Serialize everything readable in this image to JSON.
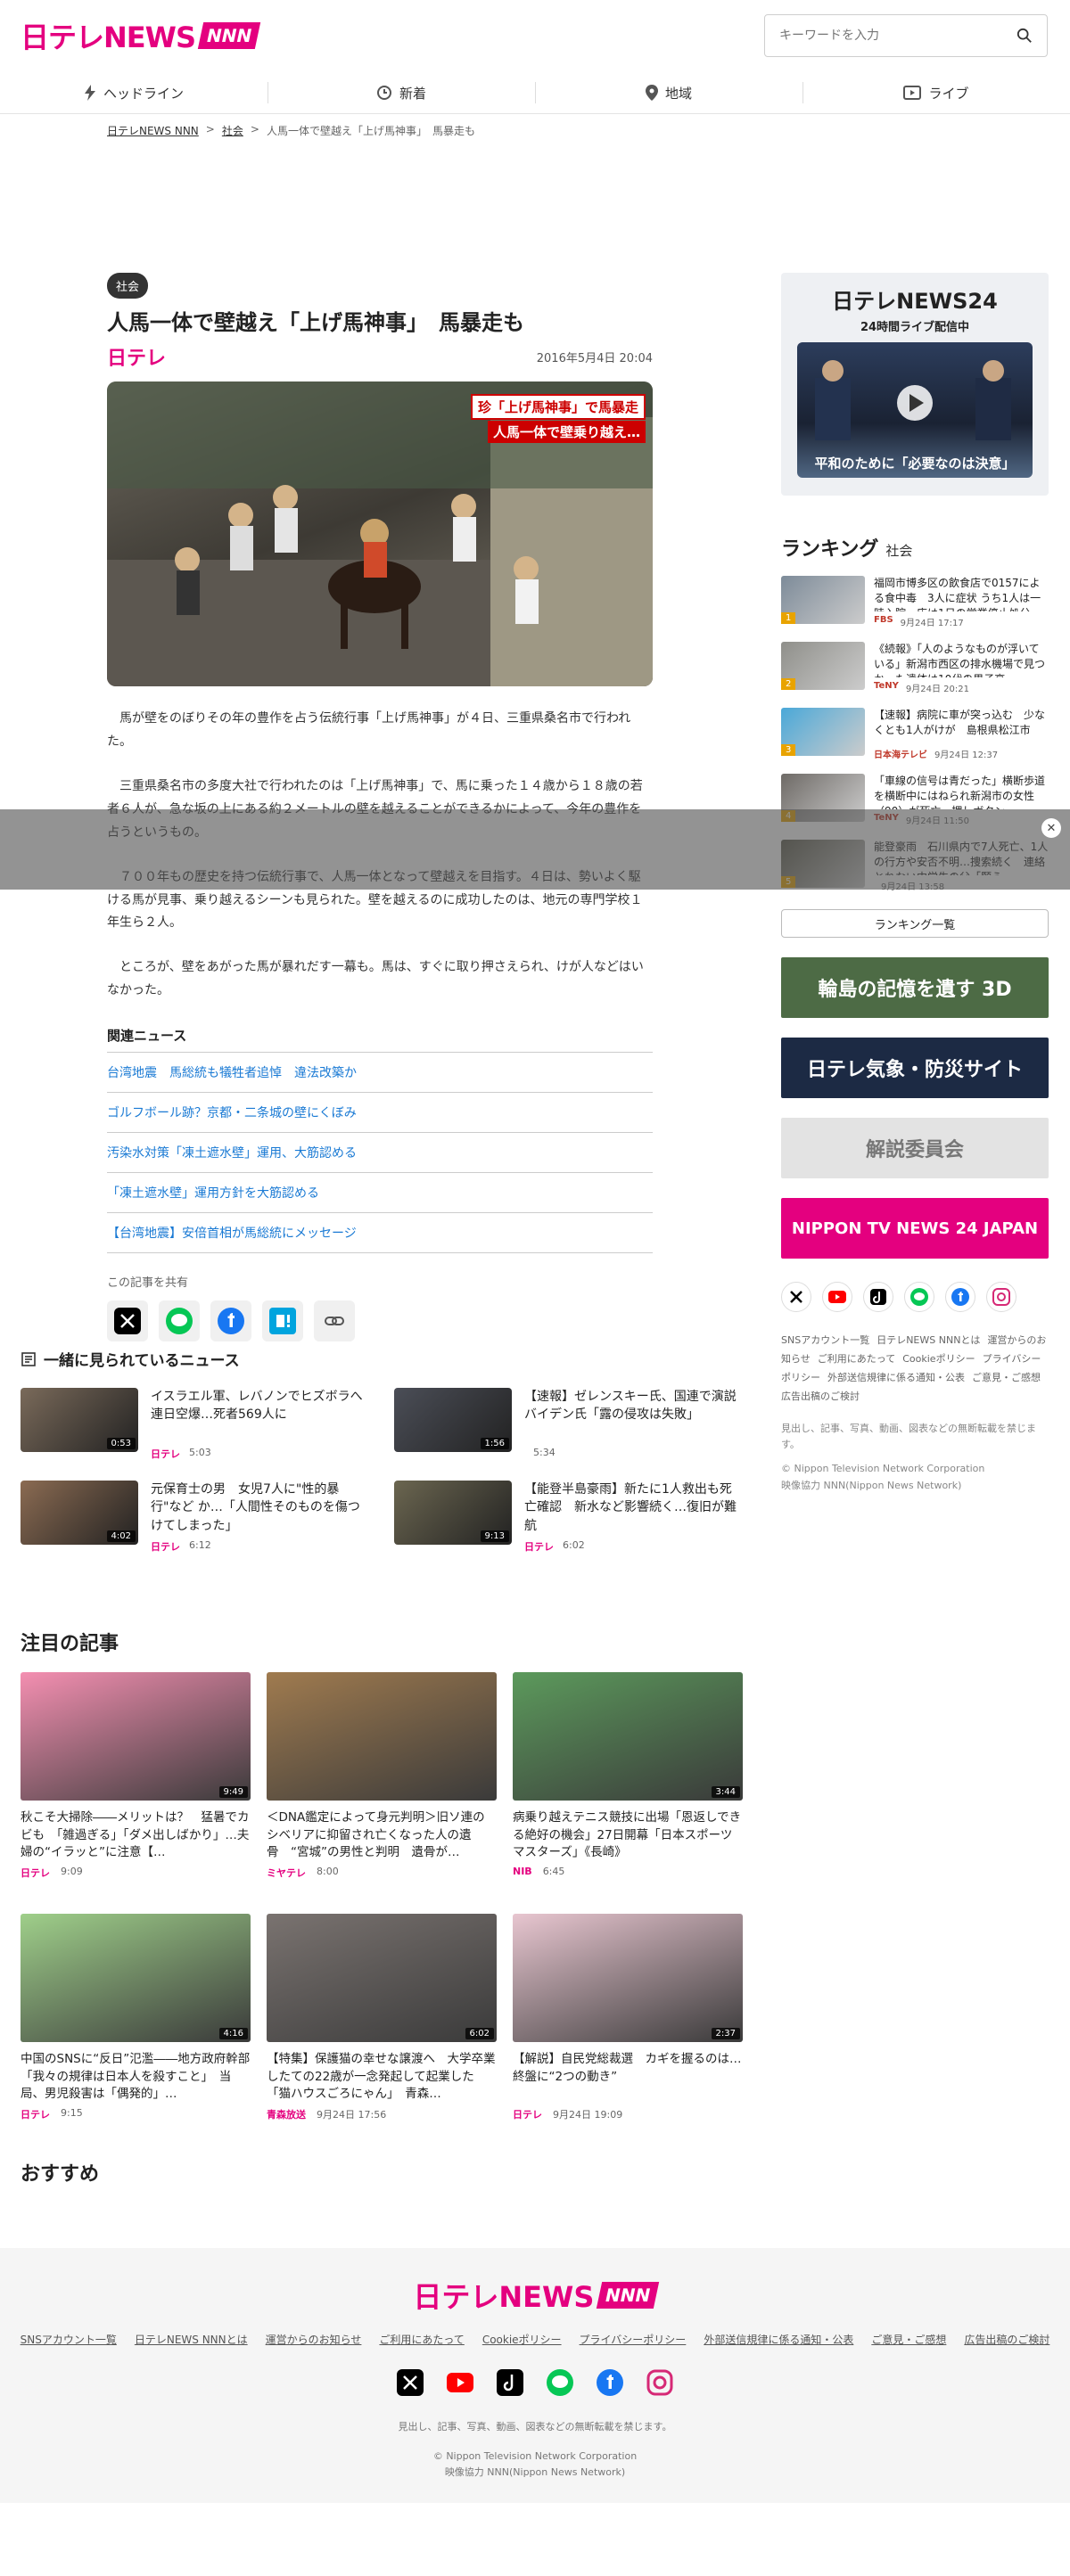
{
  "header": {
    "logo_text": "日テレNEWS",
    "logo_badge": "NNN",
    "search_placeholder": "キーワードを入力",
    "nav": [
      {
        "label": "ヘッドライン",
        "icon": "lightning-icon"
      },
      {
        "label": "新着",
        "icon": "clock-icon"
      },
      {
        "label": "地域",
        "icon": "pin-icon"
      },
      {
        "label": "ライブ",
        "icon": "play-icon"
      }
    ]
  },
  "breadcrumb": [
    "日テレNEWS NNN",
    "社会",
    "人馬一体で壁越え「上げ馬神事」　馬暴走も"
  ],
  "article": {
    "category": "社会",
    "title": "人馬一体で壁越え「上げ馬神事」　馬暴走も",
    "source": "日テレ",
    "date": "2016年5月4日 20:04",
    "hero_caption_1": "珍「上げ馬神事」で馬暴走",
    "hero_caption_2": "人馬一体で壁乗り越え…",
    "paragraphs": [
      "　馬が壁をのぼりその年の豊作を占う伝統行事「上げ馬神事」が４日、三重県桑名市で行われた。",
      "　三重県桑名市の多度大社で行われたのは「上げ馬神事」で、馬に乗った１４歳から１８歳の若者６人が、急な坂の上にある約２メートルの壁を越えることができるかによって、今年の豊作を占うというもの。",
      "　７００年もの歴史を持つ伝統行事で、人馬一体となって壁越えを目指す。４日は、勢いよく駆ける馬が見事、乗り越えるシーンも見られた。壁を越えるのに成功したのは、地元の専門学校１年生ら２人。",
      "　ところが、壁をあがった馬が暴れだす一幕も。馬は、すぐに取り押さえられ、けが人などはいなかった。"
    ],
    "related_title": "関連ニュース",
    "related": [
      "台湾地震　馬総統も犠牲者追悼　違法改築か",
      "ゴルフボール跡？京都・二条城の壁にくぼみ",
      "汚染水対策「凍土遮水壁」運用、大筋認める",
      "「凍土遮水壁」運用方針を大筋認める",
      "【台湾地震】安倍首相が馬総統にメッセージ"
    ],
    "share_label": "この記事を共有"
  },
  "sidebar": {
    "live_logo": "日テレNEWS24",
    "live_sub": "24時間ライブ配信中",
    "live_caption": "平和のために「必要なのは決意」",
    "ranking_title": "ランキング",
    "ranking_sub": "社会",
    "ranking": [
      {
        "rank": "1",
        "text": "福岡市博多区の飲食店で0157による食中毒　3人に症状 うち1人は一時入院　店は1日の営業停止処分",
        "source": "FBS",
        "time": "9月24日 17:17",
        "color": "#7d8b99"
      },
      {
        "rank": "2",
        "text": "《続報》「人のようなものが浮いている」新潟市西区の排水機場で見つかった遺体は10代の男子高…",
        "source": "TeNY",
        "time": "9月24日 20:21",
        "color": "#8f8f8a"
      },
      {
        "rank": "3",
        "text": "【速報】病院に車が突っ込む　少なくとも1人がけが　島根県松江市",
        "source": "日本海テレビ",
        "time": "9月24日 12:37",
        "color": "#4aa8d8"
      },
      {
        "rank": "4",
        "text": "「車線の信号は青だった」横断歩道を横断中にはねられ新潟市の女性（90）が死亡　押しボタン…",
        "source": "TeNY",
        "time": "9月24日 11:50",
        "color": "#6e6a66"
      },
      {
        "rank": "5",
        "text": "能登豪雨　石川県内で7人死亡、1人の行方や安否不明…捜索続く　連絡とれない中学生の父「願う…",
        "source": "",
        "time": "9月24日 13:58",
        "color": "#5b5a4b"
      }
    ],
    "ranking_button": "ランキング一覧",
    "banners": [
      {
        "label": "輪島の記憶を遺す 3D",
        "bg": "#4d6b45",
        "fg": "#ffffff"
      },
      {
        "label": "日テレ気象・防災サイト",
        "bg": "#1c2a44",
        "fg": "#ffffff"
      },
      {
        "label": "解説委員会",
        "bg": "#e3e3e3",
        "fg": "#777777"
      },
      {
        "label": "NIPPON TV NEWS 24 JAPAN",
        "bg": "#e4007f",
        "fg": "#ffffff"
      }
    ],
    "links": [
      "SNSアカウント一覧",
      "日テレNEWS NNNとは",
      "運営からのお知らせ",
      "ご利用にあたって",
      "Cookieポリシー",
      "プライバシーポリシー",
      "外部送信規律に係る通知・公表",
      "ご意見・ご感想",
      "広告出稿のご検討"
    ],
    "note": "見出し、記事、写真、動画、図表などの無断転載を禁じます。",
    "copyright": "© Nippon Television Network Corporation",
    "cooperation": "映像協力 NNN(Nippon News Network)"
  },
  "together": {
    "title": "一緒に見られているニュース",
    "items": [
      {
        "text": "イスラエル軍、レバノンでヒズボラへ連日空爆…死者569人に",
        "source": "日テレ",
        "time": "5:03",
        "duration": "0:53",
        "color": "#7a6a5a"
      },
      {
        "text": "【速報】ゼレンスキー氏、国連で演説　バイデン氏「露の侵攻は失敗」",
        "source": "",
        "time": "5:34",
        "duration": "1:56",
        "color": "#4b4e57"
      },
      {
        "text": "元保育士の男　女児7人に\"性的暴行\"など か…「人間性そのものを傷つけてしまった」",
        "source": "日テレ",
        "time": "6:12",
        "duration": "4:02",
        "color": "#8b6b52"
      },
      {
        "text": "【能登半島豪雨】新たに1人救出も死亡確認　新水など影響続く…復旧が難航",
        "source": "日テレ",
        "time": "6:02",
        "duration": "9:13",
        "color": "#6b6650"
      }
    ]
  },
  "attention": {
    "title": "注目の記事",
    "items": [
      {
        "text": "秋こそ大掃除――メリットは？　猛暑でカビも　「雑過ぎる」「ダメ出しばかり」…夫婦の“イラッと”に注意【…",
        "source": "日テレ",
        "time": "9:09",
        "duration": "9:49",
        "color": "#f48fb1"
      },
      {
        "text": "＜DNA鑑定によって身元判明＞旧ソ連のシベリアに抑留され亡くなった人の遺骨　“宮城”の男性と判明　遺骨が…",
        "source": "ミヤテレ",
        "time": "8:00",
        "duration": "",
        "color": "#a07b4f"
      },
      {
        "text": "病乗り越えテニス競技に出場「恩返しできる絶好の機会」27日開幕「日本スポーツマスターズ」《長崎》",
        "source": "NIB",
        "time": "6:45",
        "duration": "3:44",
        "color": "#5c9a5c"
      },
      {
        "text": "中国のSNSに“反日”氾濫――地方政府幹部「我々の規律は日本人を殺すこと」　当局、男児殺害は「偶発的」…",
        "source": "日テレ",
        "time": "9:15",
        "duration": "4:16",
        "color": "#9fcf8a"
      },
      {
        "text": "【特集】保護猫の幸せな譲渡へ　大学卒業したての22歳が一念発起して起業した「猫ハウスごろにゃん」　青森…",
        "source": "青森放送",
        "time": "9月24日 17:56",
        "duration": "6:02",
        "color": "#7a7370"
      },
      {
        "text": "【解説】自民党総裁選　カギを握るのは…終盤に“2つの動き”",
        "source": "日テレ",
        "time": "9月24日 19:09",
        "duration": "2:37",
        "color": "#e8c6d0"
      }
    ]
  },
  "recommend": {
    "title": "おすすめ"
  },
  "footer": {
    "links": [
      "SNSアカウント一覧",
      "日テレNEWS NNNとは",
      "運営からのお知らせ",
      "ご利用にあたって",
      "Cookieポリシー",
      "プライバシーポリシー",
      "外部送信規律に係る通知・公表",
      "ご意見・ご感想",
      "広告出稿のご検討"
    ],
    "note": "見出し、記事、写真、動画、図表などの無断転載を禁じます。",
    "copyright": "© Nippon Television Network Corporation",
    "cooperation": "映像協力 NNN(Nippon News Network)"
  },
  "colors": {
    "brand": "#e4007f",
    "link": "#1a7ad4"
  }
}
